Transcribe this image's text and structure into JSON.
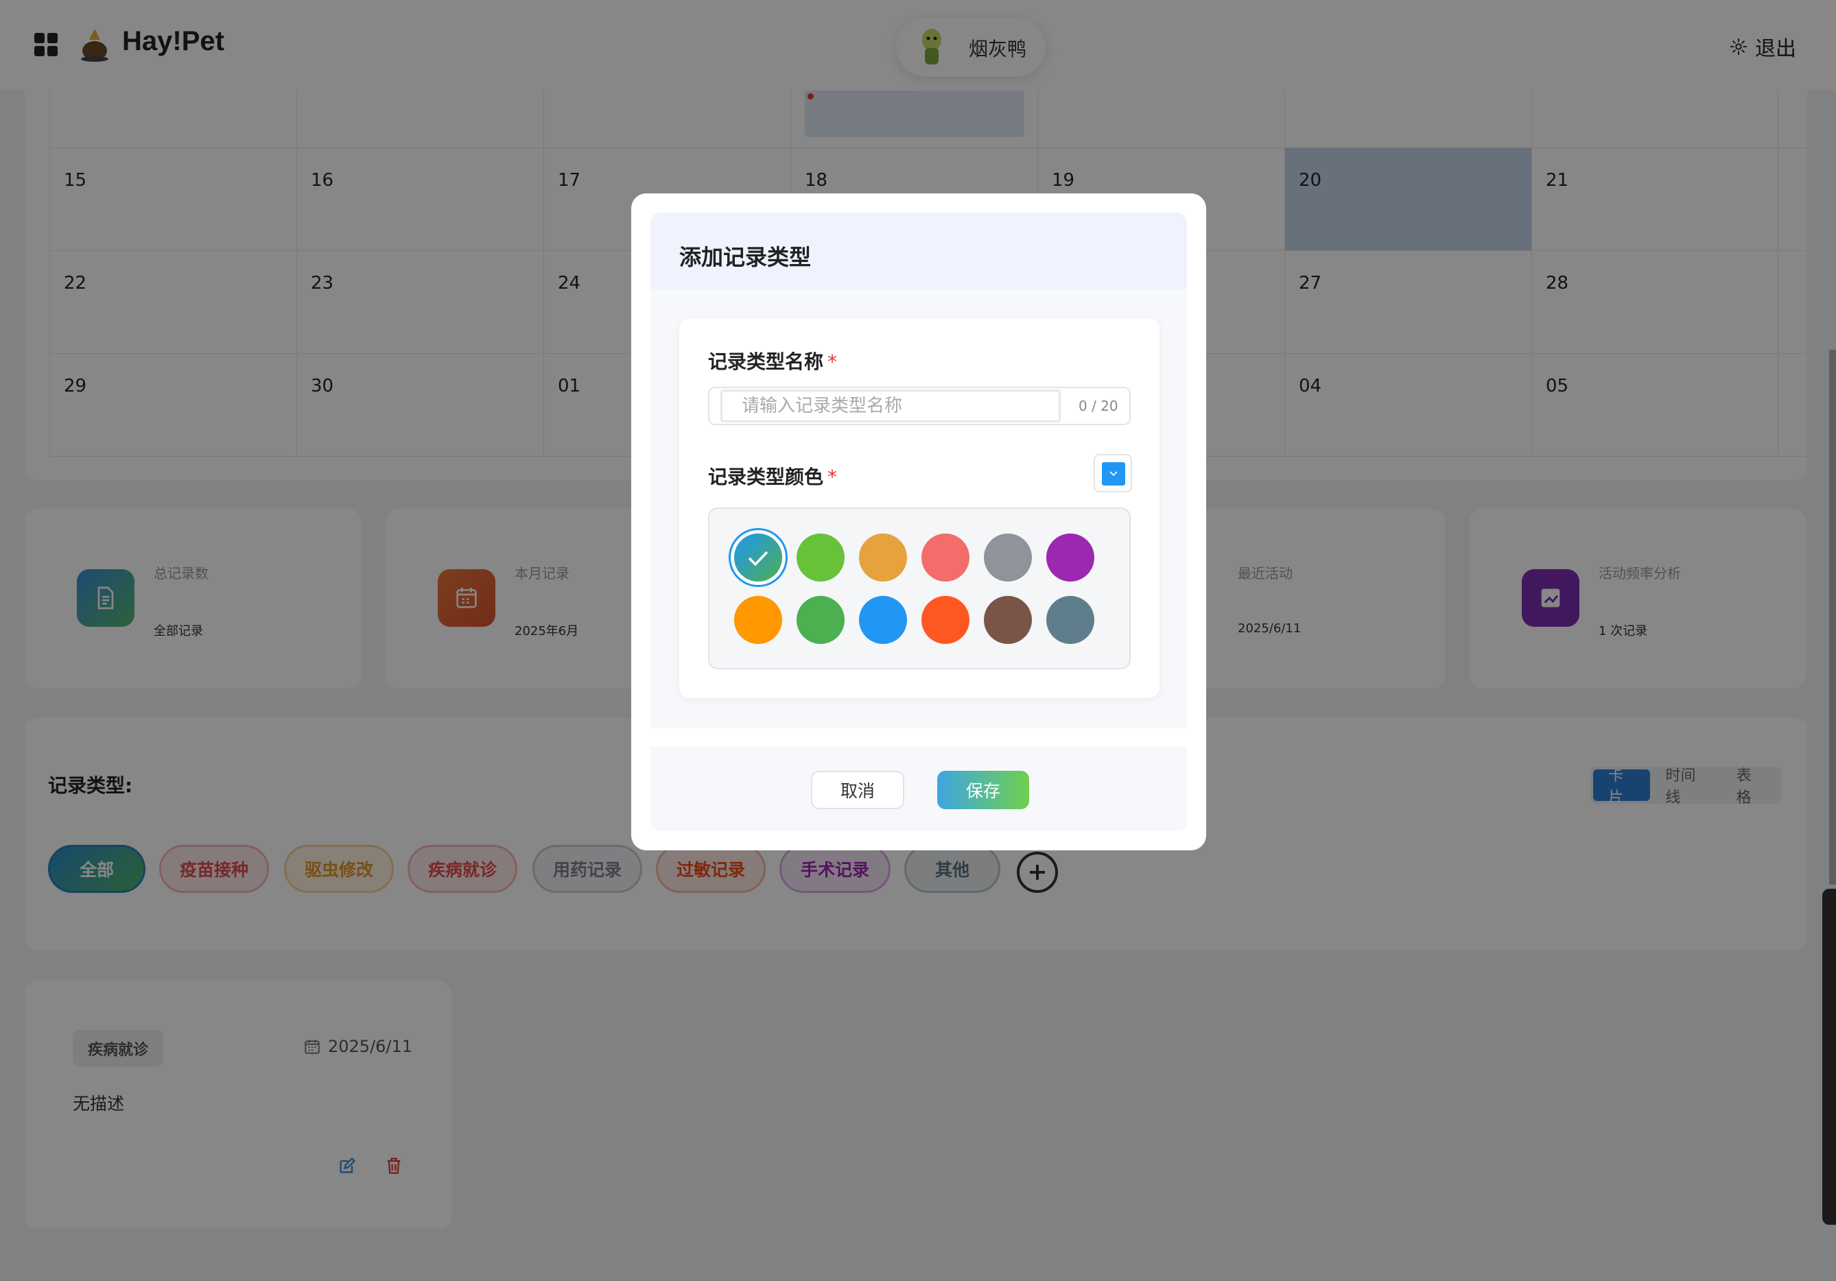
{
  "app": {
    "name": "Hay!Pet"
  },
  "header": {
    "user_name": "烟灰鸭",
    "logout_label": "退出"
  },
  "calendar": {
    "rows": [
      [
        "",
        "",
        "",
        "",
        "",
        "",
        ""
      ],
      [
        "15",
        "16",
        "17",
        "18",
        "19",
        "20",
        "21"
      ],
      [
        "22",
        "23",
        "24",
        "",
        "",
        "27",
        "28"
      ],
      [
        "29",
        "30",
        "01",
        "",
        "",
        "04",
        "05"
      ]
    ],
    "today": "20"
  },
  "stats": [
    {
      "title": "总记录数",
      "sub": "全部记录",
      "color": "#3a8fd6",
      "icon": "document-icon"
    },
    {
      "title": "本月记录",
      "sub": "2025年6月",
      "color": "#e8743a",
      "icon": "calendar-icon"
    },
    {
      "title": "最近活动",
      "sub": "2025/6/11",
      "color": "#9e9e9e",
      "icon": "clock-icon"
    },
    {
      "title": "活动频率分析",
      "sub": "1 次记录",
      "color": "#7b2fb0",
      "icon": "trend-icon"
    }
  ],
  "types": {
    "label": "记录类型:",
    "views": [
      "卡片",
      "时间线",
      "表格"
    ],
    "active_view": "卡片",
    "chips": [
      {
        "label": "全部",
        "color": "#2e8bc9"
      },
      {
        "label": "疫苗接种",
        "color": "#f06a6a"
      },
      {
        "label": "驱虫修改",
        "color": "#e6a23c"
      },
      {
        "label": "疾病就诊",
        "color": "#f06a6a"
      },
      {
        "label": "用药记录",
        "color": "#909399"
      },
      {
        "label": "过敏记录",
        "color": "#ff5722"
      },
      {
        "label": "手术记录",
        "color": "#9c27b0"
      },
      {
        "label": "其他",
        "color": "#607d8b"
      }
    ]
  },
  "record": {
    "tag": "疾病就诊",
    "date": "2025/6/11",
    "description": "无描述"
  },
  "modal": {
    "title": "添加记录类型",
    "name_label": "记录类型名称",
    "name_placeholder": "请输入记录类型名称",
    "name_count": "0 / 20",
    "color_label": "记录类型颜色",
    "required_mark": "*",
    "selected_color": "#2196f3",
    "swatches": [
      "#2196f3",
      "#67c23a",
      "#e6a23c",
      "#f56c6c",
      "#909399",
      "#9c27b0",
      "#ff9800",
      "#4caf50",
      "#2196f3",
      "#ff5722",
      "#795548",
      "#607d8b"
    ],
    "cancel_label": "取消",
    "save_label": "保存"
  }
}
